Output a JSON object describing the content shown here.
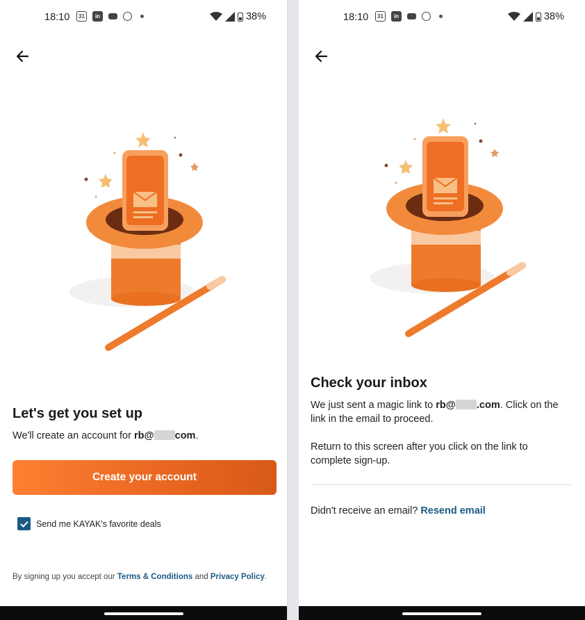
{
  "colors": {
    "accent_orange": "#e86620",
    "link_blue": "#1c5a86",
    "nav_bar": "#0c0c0c"
  },
  "status_bar": {
    "time": "18:10",
    "calendar_icon_text": "31",
    "linkedin_icon_text": "in",
    "battery": "38%",
    "icons": [
      "calendar-icon",
      "linkedin-icon",
      "message-icon",
      "record-icon",
      "dot-icon",
      "wifi-icon",
      "signal-icon",
      "battery-icon"
    ]
  },
  "left_screen": {
    "title": "Let's get you set up",
    "subtitle_prefix": "We'll create an account for ",
    "email_start": "rb@",
    "email_end": "com",
    "subtitle_suffix": ".",
    "create_button": "Create your account",
    "checkbox_label": "Send me KAYAK's favorite deals",
    "checkbox_checked": true,
    "legal_prefix": "By signing up you accept our ",
    "terms_link": "Terms & Conditions",
    "legal_and": " and ",
    "privacy_link": "Privacy Policy",
    "legal_suffix": "."
  },
  "right_screen": {
    "title": "Check your inbox",
    "para1_prefix": "We just sent a magic link to ",
    "email_start": "rb@",
    "email_end": ".com",
    "para1_suffix": ". Click on the link in the email to proceed.",
    "para2": "Return to this screen after you click on the link to complete sign-up.",
    "resend_prefix": "Didn't receive an email? ",
    "resend_link": "Resend email"
  }
}
